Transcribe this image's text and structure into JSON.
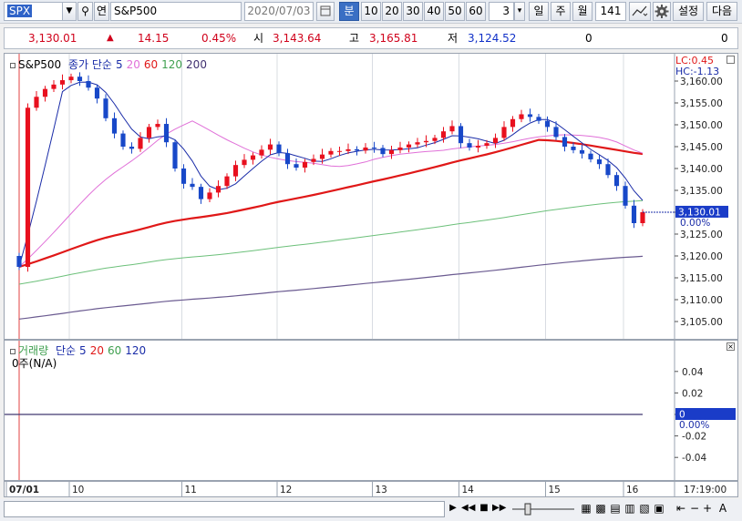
{
  "toolbar": {
    "symbol_code": "SPX",
    "dropdown_glyph": "▼",
    "search_glyph": "⚲",
    "link_label": "연",
    "symbol_name": "S&P500",
    "date": "2020/07/03",
    "period_unit": "분",
    "intervals": [
      "10",
      "20",
      "30",
      "40",
      "50",
      "60"
    ],
    "interval_count": "3",
    "spin_glyph": "▾",
    "day_label": "일",
    "week_label": "주",
    "month_label": "월",
    "bar_count": "141",
    "settings_label": "설정",
    "next_label": "다음"
  },
  "quote": {
    "price": "3,130.01",
    "change_arrow": "▲",
    "change": "14.15",
    "change_pct": "0.45%",
    "open_label": "시",
    "open": "3,143.64",
    "high_label": "고",
    "high": "3,165.81",
    "low_label": "저",
    "low": "3,124.52",
    "volume": "0",
    "volume2": "0"
  },
  "price_pane": {
    "legend_symbol": "S&P500",
    "legend_ma_title": "종가 단순",
    "legend_periods": [
      "5",
      "20",
      "60",
      "120",
      "200"
    ],
    "lc_label": "LC:0.45",
    "hc_label": "HC:-1.13",
    "current_price_tag": "3,130.01",
    "current_pct_tag": "0.00%"
  },
  "volume_pane": {
    "legend_title": "거래량",
    "legend_ma_title": "단순",
    "legend_periods": [
      "5",
      "20",
      "60",
      "120"
    ],
    "status_text": "0주(N/A)",
    "current_tag": "0",
    "current_pct_tag": "0.00%",
    "ticks": [
      "0.04",
      "0.02",
      "0",
      "-0.02",
      "-0.04"
    ]
  },
  "date_axis": {
    "first_label": "07/01",
    "time_label": "17:19:00"
  },
  "colors": {
    "up": "#e8101e",
    "down": "#1848c8",
    "ma5": "#1a2ca8",
    "ma20": "#e070d8",
    "ma60": "#e01818",
    "ma120": "#6cc07a",
    "ma200": "#6a5a90"
  },
  "chart_data": [
    {
      "type": "candlestick",
      "series_name": "S&P500",
      "x_labels": [
        "07/01",
        "10",
        "11",
        "12",
        "13",
        "14",
        "15",
        "16"
      ],
      "y_ticks": [
        "3,160.00",
        "3,155.00",
        "3,150.00",
        "3,145.00",
        "3,140.00",
        "3,135.00",
        "3,130.00",
        "3,125.00",
        "3,120.00",
        "3,115.00",
        "3,110.00",
        "3,105.00"
      ],
      "ylim": [
        3102.5,
        3165.0
      ],
      "y_scale": [
        3160,
        3155,
        3150,
        3145,
        3140,
        3135,
        3130,
        3125,
        3120,
        3115,
        3110,
        3105
      ],
      "closes": [
        3117.5,
        3153.9,
        3156.4,
        3158.2,
        3159.2,
        3160.2,
        3161.0,
        3160.0,
        3158.5,
        3156.0,
        3151.5,
        3148.0,
        3145.0,
        3144.5,
        3147.0,
        3149.5,
        3150.2,
        3146.0,
        3140.0,
        3136.5,
        3135.8,
        3133.0,
        3134.5,
        3136.0,
        3138.2,
        3140.8,
        3142.0,
        3143.0,
        3144.3,
        3145.5,
        3143.5,
        3141.0,
        3140.2,
        3141.5,
        3142.2,
        3143.2,
        3144.0,
        3144.0,
        3144.4,
        3144.1,
        3144.8,
        3144.7,
        3143.3,
        3144.2,
        3144.8,
        3145.5,
        3146.0,
        3146.3,
        3147.0,
        3148.5,
        3149.7,
        3145.8,
        3144.8,
        3145.2,
        3145.8,
        3147.0,
        3149.5,
        3151.3,
        3152.4,
        3151.8,
        3150.9,
        3149.5,
        3147.2,
        3145.0,
        3144.2,
        3143.4,
        3142.1,
        3141.0,
        3138.5,
        3136.0,
        3131.5,
        3127.5,
        3130.01
      ],
      "ma_periods": [
        5,
        20,
        60,
        120,
        200
      ],
      "current_price": 3130.01
    },
    {
      "type": "bar",
      "series_name": "거래량",
      "y_ticks": [
        "0.04",
        "0.02",
        "0",
        "-0.02",
        "-0.04"
      ],
      "ylim": [
        -0.05,
        0.05
      ],
      "values": [
        0
      ]
    }
  ]
}
